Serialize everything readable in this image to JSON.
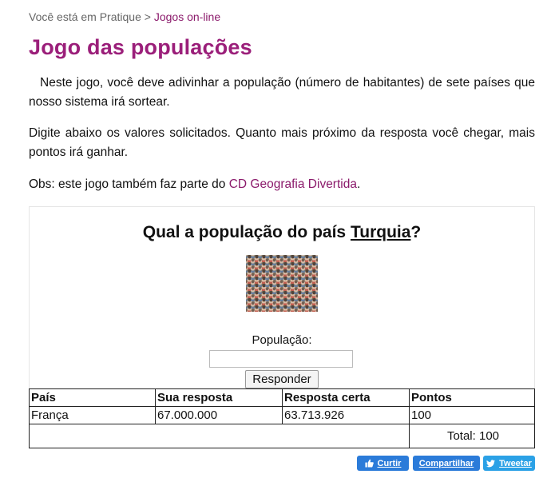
{
  "breadcrumb": {
    "prefix": "Você está em Pratique",
    "separator": ">",
    "current": "Jogos on-line"
  },
  "page": {
    "title": "Jogo das populações",
    "intro": "Neste jogo, você deve adivinhar a população (número de habitantes) de sete países que nosso sistema irá sortear.",
    "instructions": "Digite abaixo os valores solicitados. Quanto mais próximo da resposta você chegar, mais pontos irá ganhar.",
    "obs_prefix": "Obs: este jogo também faz parte do",
    "obs_link": "CD Geografia Divertida",
    "obs_suffix": "."
  },
  "game": {
    "question_prefix": "Qual a população do país",
    "country": "Turquia",
    "question_suffix": "?",
    "image_icon": "crowd-image",
    "population_label": "População:",
    "population_value": "",
    "submit_label": "Responder"
  },
  "results": {
    "headers": [
      "País",
      "Sua resposta",
      "Resposta certa",
      "Pontos"
    ],
    "rows": [
      [
        "França",
        "67.000.000",
        "63.713.926",
        "100"
      ]
    ],
    "total": "Total: 100"
  },
  "social": {
    "like_label": "Curtir",
    "share_label": "Compartilhar",
    "tweet_label": "Tweetar",
    "like_icon": "thumbs-up-icon",
    "tweet_icon": "twitter-bird-icon",
    "facebook_color": "#2b7bd9",
    "twitter_color": "#2ba1e6"
  },
  "colors": {
    "brand": "#9b1f7a",
    "link": "#8b1a6b"
  }
}
